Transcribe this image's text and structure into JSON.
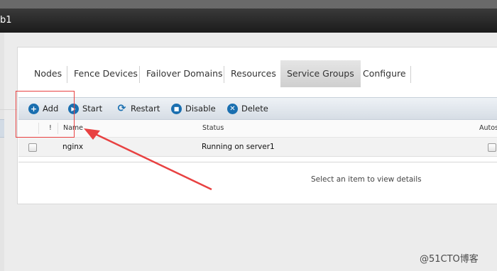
{
  "window": {
    "title_fragment": "b1"
  },
  "tabs": [
    {
      "label": "Nodes",
      "active": false
    },
    {
      "label": "Fence Devices",
      "active": false
    },
    {
      "label": "Failover Domains",
      "active": false
    },
    {
      "label": "Resources",
      "active": false
    },
    {
      "label": "Service Groups",
      "active": true
    },
    {
      "label": "Configure",
      "active": false
    }
  ],
  "toolbar": {
    "add": {
      "label": "Add",
      "icon": "plus-circle-icon"
    },
    "start": {
      "label": "Start",
      "icon": "play-circle-icon"
    },
    "restart": {
      "label": "Restart",
      "icon": "refresh-icon"
    },
    "disable": {
      "label": "Disable",
      "icon": "stop-circle-icon"
    },
    "delete": {
      "label": "Delete",
      "icon": "x-circle-icon"
    }
  },
  "table": {
    "columns": [
      "!",
      "Name",
      "Status",
      "Autost"
    ],
    "rows": [
      {
        "name": "nginx",
        "status": "Running on server1"
      }
    ]
  },
  "details": {
    "placeholder": "Select an item to view details"
  },
  "watermark": "@51CTO博客",
  "colors": {
    "annotation": "#e84141",
    "accent": "#1a6fb0"
  }
}
